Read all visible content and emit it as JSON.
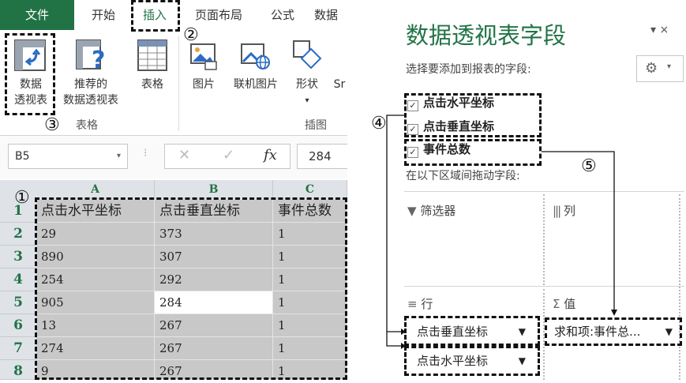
{
  "ribbon": {
    "tabs": [
      "文件",
      "开始",
      "插入",
      "页面布局",
      "公式",
      "数据"
    ],
    "buttons": {
      "pivot_table": [
        "数据",
        "透视表"
      ],
      "recommended_pivot": [
        "推荐的",
        "数据透视表"
      ],
      "table": "表格",
      "pictures": "图片",
      "online_pictures": "联机图片",
      "shapes": "形状",
      "smartart_partial": "Sr"
    },
    "groups": {
      "tables": "表格",
      "illustrations": "插图"
    }
  },
  "formula_bar": {
    "name_box": "B5",
    "fx": "fx",
    "value": "284",
    "cancel_symbol": "✕",
    "enter_symbol": "✓"
  },
  "sheet": {
    "columns": [
      "A",
      "B",
      "C"
    ],
    "rows": [
      "1",
      "2",
      "3",
      "4",
      "5",
      "6",
      "7",
      "8"
    ],
    "cells": [
      [
        "点击水平坐标",
        "点击垂直坐标",
        "事件总数"
      ],
      [
        "29",
        "373",
        "1"
      ],
      [
        "890",
        "307",
        "1"
      ],
      [
        "254",
        "292",
        "1"
      ],
      [
        "905",
        "284",
        "1"
      ],
      [
        "13",
        "267",
        "1"
      ],
      [
        "274",
        "267",
        "1"
      ],
      [
        "9",
        "267",
        "1"
      ]
    ]
  },
  "pivot_pane": {
    "title": "数据透视表字段",
    "subtitle": "选择要添加到报表的字段:",
    "fields": [
      "点击水平坐标",
      "点击垂直坐标",
      "事件总数"
    ],
    "drag_hint": "在以下区域间拖动字段:",
    "areas": {
      "filters": "筛选器",
      "columns": "列",
      "rows": "行",
      "values": "值"
    },
    "row_items": [
      "点击垂直坐标",
      "点击水平坐标"
    ],
    "value_items": [
      "求和项:事件总..."
    ]
  },
  "annotations": [
    "①",
    "②",
    "③",
    "④",
    "⑤"
  ],
  "colors": {
    "excel_green": "#217346",
    "selection_gray": "#c8c8c8"
  }
}
